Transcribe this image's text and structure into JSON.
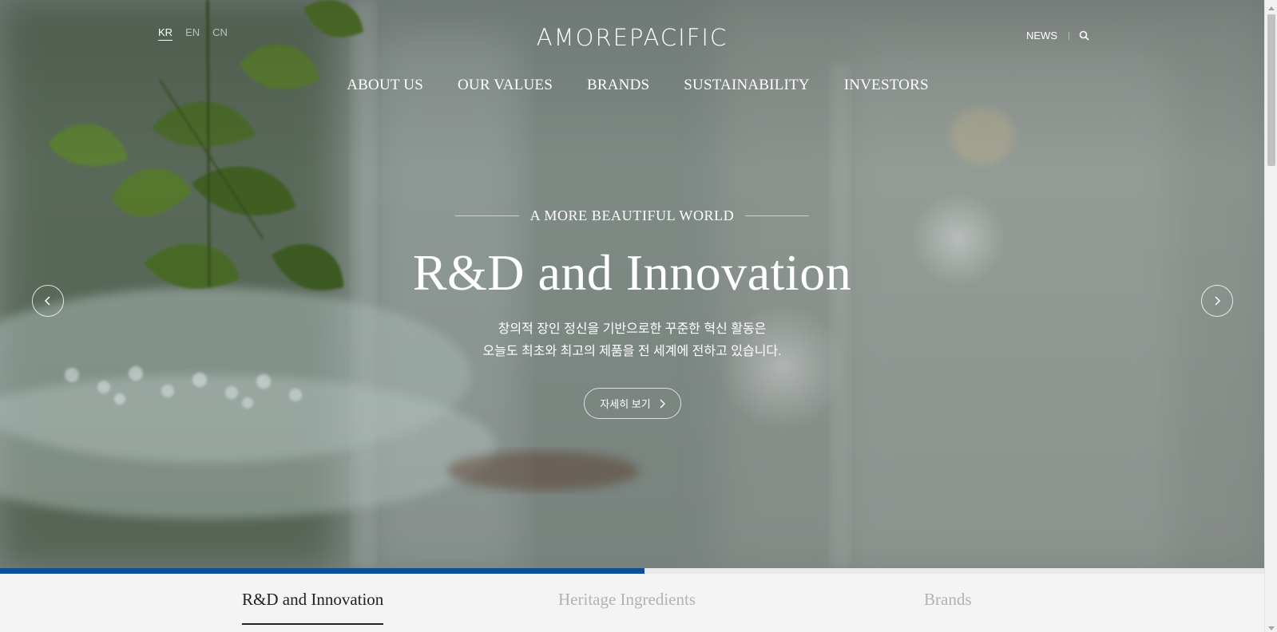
{
  "languages": [
    {
      "label": "KR",
      "active": true
    },
    {
      "label": "EN",
      "active": false
    },
    {
      "label": "CN",
      "active": false
    }
  ],
  "logo": {
    "text": "AMOREPACIFIC"
  },
  "utility": {
    "news_label": "NEWS",
    "search_icon": "search-icon"
  },
  "nav": {
    "items": [
      "ABOUT US",
      "OUR VALUES",
      "BRANDS",
      "SUSTAINABILITY",
      "INVESTORS"
    ]
  },
  "hero": {
    "eyebrow": "A MORE BEAUTIFUL WORLD",
    "title": "R&D and Innovation",
    "desc_line1": "창의적 장인 정신을 기반으로한 꾸준한 혁신 활동은",
    "desc_line2": "오늘도 최초와 최고의 제품을 전 세계에 전하고 있습니다.",
    "button_label": "자세히 보기",
    "prev_icon": "chevron-left-icon",
    "next_icon": "chevron-right-icon"
  },
  "slider": {
    "progress": 0.51,
    "accent_color": "#0d4f96",
    "tabs": [
      {
        "label": "R&D and Innovation",
        "active": true
      },
      {
        "label": "Heritage Ingredients",
        "active": false
      },
      {
        "label": "Brands",
        "active": false
      }
    ]
  }
}
